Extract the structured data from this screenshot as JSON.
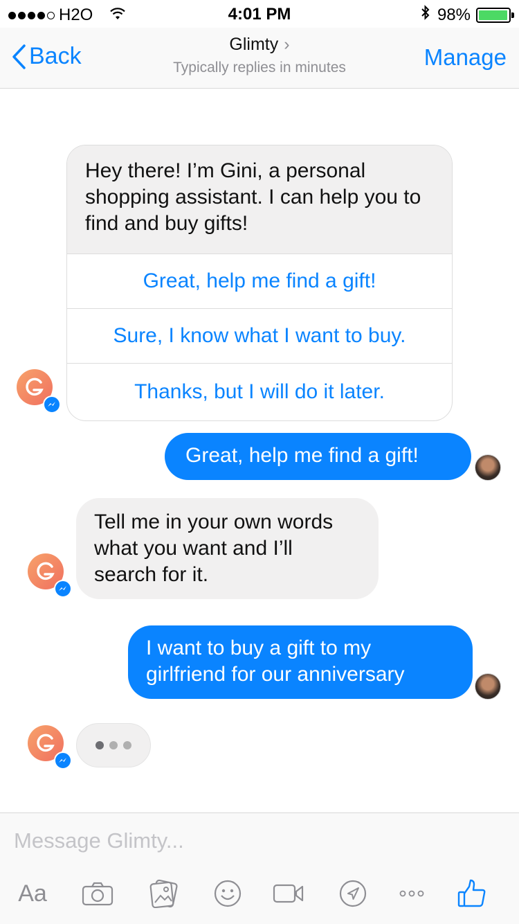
{
  "status_bar": {
    "carrier": "H2O",
    "time": "4:01 PM",
    "battery": "98%",
    "battery_level": 0.98,
    "signal_bars": 4
  },
  "nav": {
    "back_label": "Back",
    "title": "Glimty",
    "subtitle": "Typically replies in minutes",
    "manage_label": "Manage"
  },
  "chat": {
    "intro_text": "Hey there! I’m Gini, a personal shopping assistant. I can help you to find and buy gifts!",
    "quick_replies": [
      "Great, help me find a gift!",
      "Sure, I know what I want to buy.",
      "Thanks, but I will do it later."
    ],
    "user_message_1": "Great, help me find a gift!",
    "bot_message_2": "Tell me in your own words what you want and I’ll search for it.",
    "user_message_2": "I want to buy a gift to my girlfriend for our anniversary"
  },
  "composer": {
    "placeholder": "Message Glimty...",
    "aa_label": "Aa",
    "icons": [
      "aa-icon",
      "camera-icon",
      "gallery-icon",
      "emoji-icon",
      "video-icon",
      "location-icon",
      "more-icon",
      "like-icon"
    ]
  },
  "colors": {
    "accent": "#0a84ff",
    "incoming_bubble": "#f1f0f0",
    "battery_green": "#4cd964",
    "bot_avatar": "#f28a63"
  }
}
